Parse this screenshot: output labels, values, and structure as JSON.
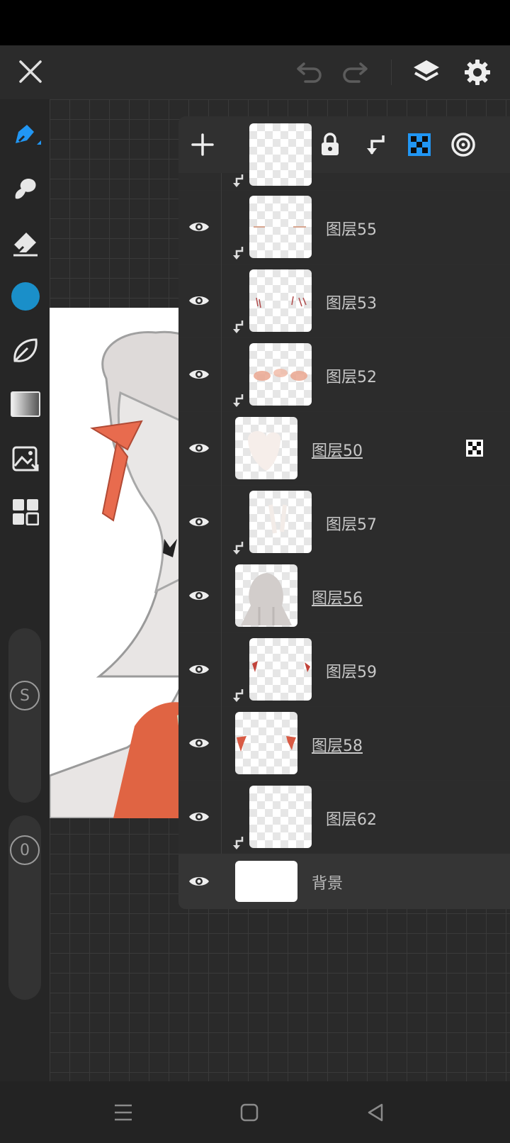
{
  "toolbar": {
    "icons": [
      "close-icon",
      "undo-icon",
      "redo-icon",
      "layers-icon",
      "settings-icon"
    ]
  },
  "left_tools": {
    "icons": [
      "pen-icon",
      "smudge-icon",
      "eraser-icon",
      "color-swatch",
      "leaf-icon",
      "gradient-icon",
      "image-import-icon",
      "grid-apps-icon"
    ],
    "color": "#1a8fc9",
    "size_badge": "S",
    "opacity_badge": "0"
  },
  "layers_panel": {
    "toolbar_icons": [
      "add-layer-icon",
      "folder-icon",
      "lock-icon",
      "clip-icon",
      "alpha-lock-icon",
      "blend-icon"
    ],
    "accent": "#2196f3",
    "layers": [
      {
        "name": "图层55",
        "clipped": true,
        "underline": false,
        "alpha": false
      },
      {
        "name": "图层53",
        "clipped": true,
        "underline": false,
        "alpha": false
      },
      {
        "name": "图层52",
        "clipped": true,
        "underline": false,
        "alpha": false
      },
      {
        "name": "图层50",
        "clipped": false,
        "underline": true,
        "alpha": true
      },
      {
        "name": "图层57",
        "clipped": true,
        "underline": false,
        "alpha": false
      },
      {
        "name": "图层56",
        "clipped": false,
        "underline": true,
        "alpha": false
      },
      {
        "name": "图层59",
        "clipped": true,
        "underline": false,
        "alpha": false
      },
      {
        "name": "图层58",
        "clipped": false,
        "underline": true,
        "alpha": false
      },
      {
        "name": "图层62",
        "clipped": true,
        "underline": false,
        "alpha": false
      }
    ],
    "background_layer": "背景"
  },
  "navbar": {
    "icons": [
      "menu-icon",
      "home-icon",
      "back-icon"
    ]
  }
}
